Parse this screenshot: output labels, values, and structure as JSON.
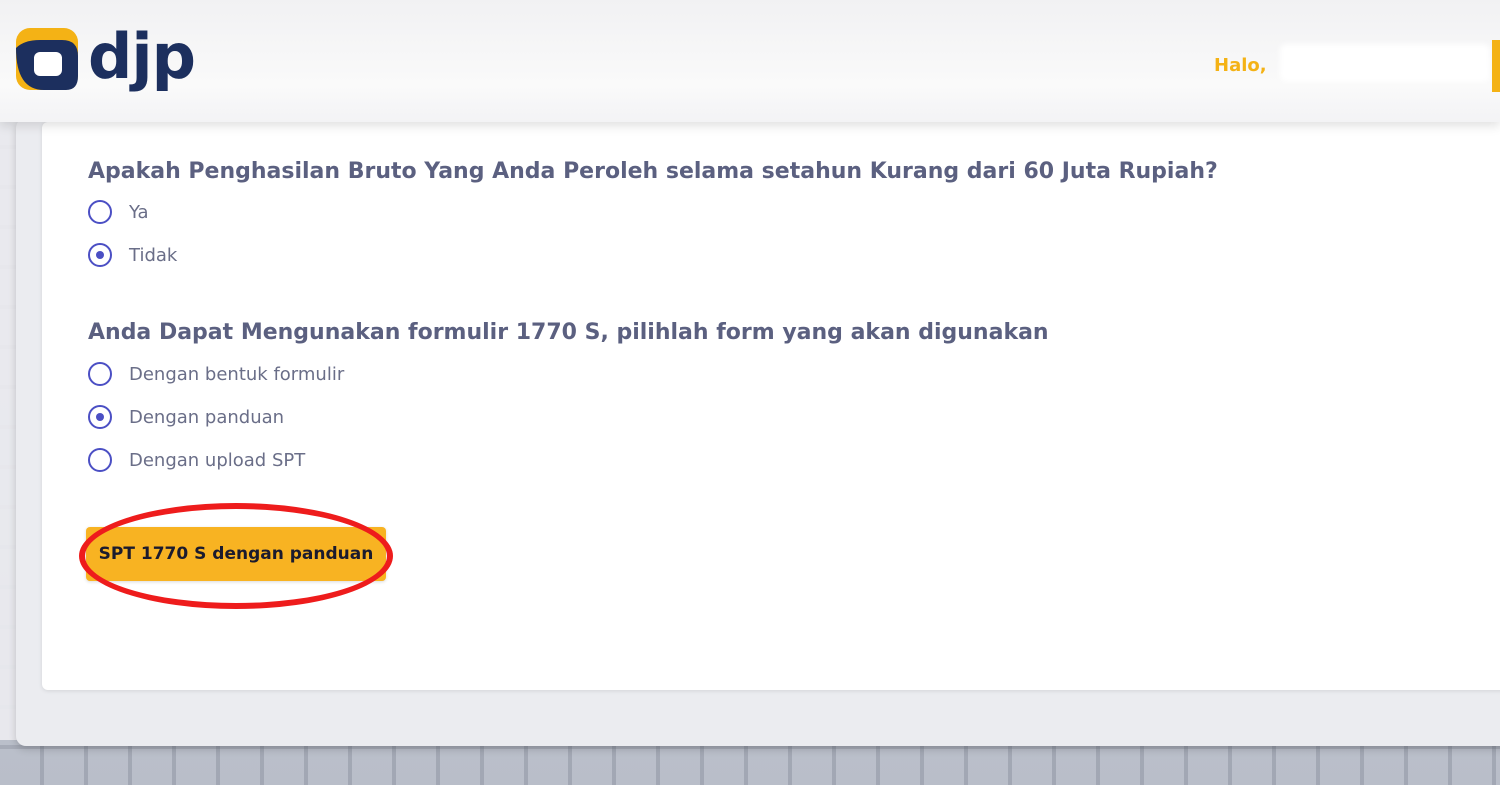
{
  "header": {
    "logo_text": "djp",
    "greeting": "Halo,"
  },
  "form": {
    "question1": {
      "text": "Apakah Penghasilan Bruto Yang Anda Peroleh selama setahun Kurang dari 60 Juta Rupiah?",
      "options": [
        {
          "label": "Ya",
          "selected": false
        },
        {
          "label": "Tidak",
          "selected": true
        }
      ]
    },
    "question2": {
      "text": "Anda Dapat Mengunakan formulir 1770 S, pilihlah form yang akan digunakan",
      "options": [
        {
          "label": "Dengan bentuk formulir",
          "selected": false
        },
        {
          "label": "Dengan panduan",
          "selected": true
        },
        {
          "label": "Dengan upload SPT",
          "selected": false
        }
      ]
    },
    "submit_label": "SPT 1770 S dengan panduan"
  },
  "colors": {
    "accent": "#f8b322",
    "radio": "#4b4fc4",
    "highlight": "#ee1c1c",
    "brand_navy": "#1c2f5e"
  }
}
